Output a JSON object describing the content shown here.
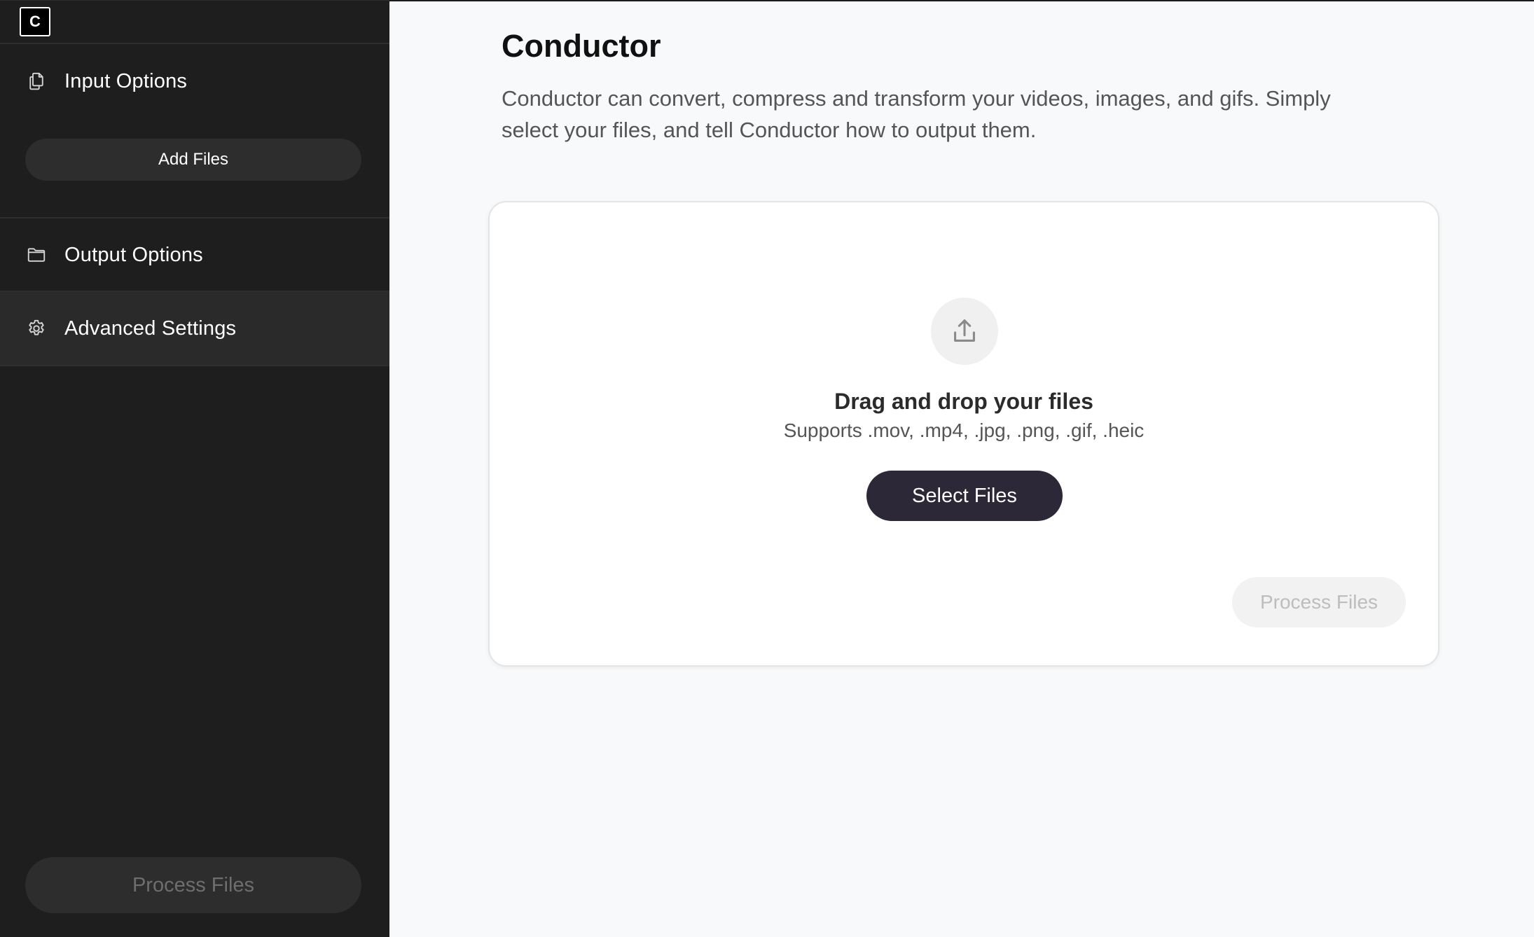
{
  "app": {
    "logo_letter": "C"
  },
  "sidebar": {
    "sections": [
      {
        "label": "Input Options",
        "icon": "copy-icon"
      },
      {
        "label": "Output Options",
        "icon": "folder-icon"
      },
      {
        "label": "Advanced Settings",
        "icon": "gear-icon",
        "active": true
      }
    ],
    "add_files_label": "Add Files",
    "process_label": "Process Files"
  },
  "main": {
    "title": "Conductor",
    "description": "Conductor can convert, compress and transform your videos, images, and gifs. Simply select your files, and tell Conductor how to output them.",
    "dropzone": {
      "icon": "upload-icon",
      "title": "Drag and drop your files",
      "subtitle": "Supports .mov, .mp4, .jpg, .png, .gif, .heic",
      "select_label": "Select Files",
      "process_label": "Process Files"
    }
  },
  "colors": {
    "sidebar_bg": "#1e1e1e",
    "active_section_bg": "#2a2a2a",
    "primary_button": "#2d2838",
    "page_bg": "#f8f9fa"
  }
}
